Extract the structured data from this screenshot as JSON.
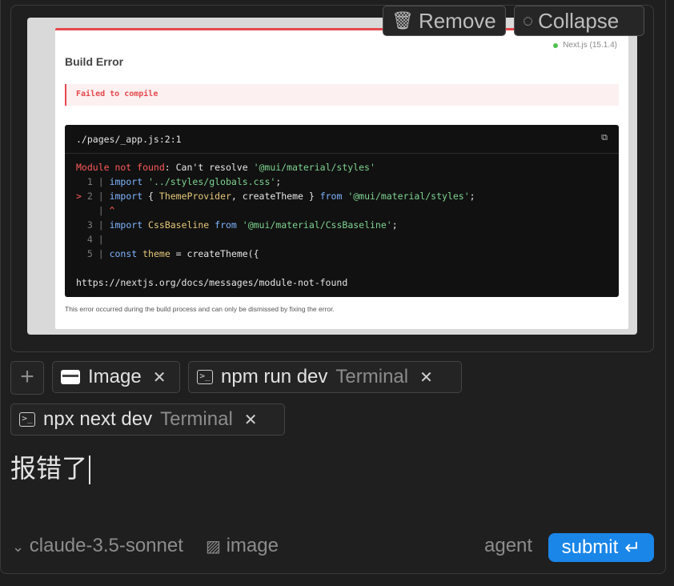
{
  "toolbar": {
    "remove_label": "Remove",
    "collapse_label": "Collapse"
  },
  "screenshot": {
    "title": "Build Error",
    "version": "Next.js (15.1.4)",
    "failed": "Failed to compile",
    "file_path": "./pages/_app.js:2:1",
    "error_kind": "Module not found",
    "error_msg": ": Can't resolve ",
    "error_module": "'@mui/material/styles'",
    "lines": [
      {
        "marker": "  ",
        "num": "1",
        "code": "import '../styles/globals.css';"
      },
      {
        "marker": "> ",
        "num": "2",
        "code": "import { ThemeProvider, createTheme } from '@mui/material/styles';"
      },
      {
        "marker": "  ",
        "num": " ",
        "code": "^"
      },
      {
        "marker": "  ",
        "num": "3",
        "code": "import CssBaseline from '@mui/material/CssBaseline';"
      },
      {
        "marker": "  ",
        "num": "4",
        "code": ""
      },
      {
        "marker": "  ",
        "num": "5",
        "code": "const theme = createTheme({"
      }
    ],
    "link": "https://nextjs.org/docs/messages/module-not-found",
    "footer": "This error occurred during the build process and can only be dismissed by fixing the error."
  },
  "context_chips": [
    {
      "label": "Image",
      "type": "",
      "icon": "image-icon"
    },
    {
      "label": "npm run dev",
      "type": "Terminal",
      "icon": "terminal-icon"
    },
    {
      "label": "npx next dev",
      "type": "Terminal",
      "icon": "terminal-icon"
    }
  ],
  "input": {
    "value": "报错了"
  },
  "footer": {
    "model": "claude-3.5-sonnet",
    "image_label": "image",
    "mode": "agent",
    "submit_label": "submit"
  },
  "colors": {
    "accent": "#1a86e8",
    "error": "#e5484d"
  }
}
